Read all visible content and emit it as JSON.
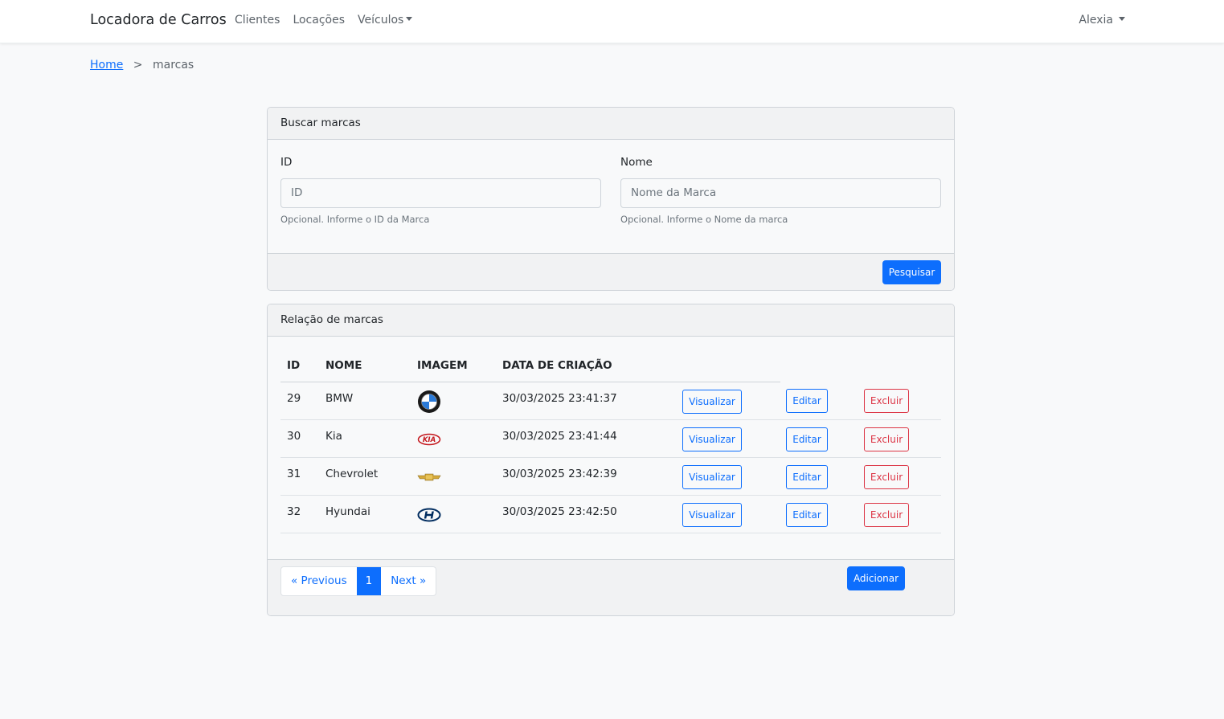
{
  "navbar": {
    "brand": "Locadora de Carros",
    "links": [
      "Clientes",
      "Locações",
      "Veículos"
    ],
    "user": "Alexia"
  },
  "breadcrumb": {
    "home": "Home",
    "separator": ">",
    "current": "marcas"
  },
  "search": {
    "title": "Buscar marcas",
    "id_label": "ID",
    "id_placeholder": "ID",
    "id_help": "Opcional. Informe o ID da Marca",
    "name_label": "Nome",
    "name_placeholder": "Nome da Marca",
    "name_help": "Opcional. Informe o Nome da marca",
    "submit": "Pesquisar"
  },
  "list": {
    "title": "Relação de marcas",
    "columns": [
      "ID",
      "NOME",
      "IMAGEM",
      "DATA DE CRIAÇÃO"
    ],
    "rows": [
      {
        "id": "29",
        "name": "BMW",
        "logo": "bmw-logo",
        "created": "30/03/2025 23:41:37"
      },
      {
        "id": "30",
        "name": "Kia",
        "logo": "kia-logo",
        "created": "30/03/2025 23:41:44"
      },
      {
        "id": "31",
        "name": "Chevrolet",
        "logo": "chevrolet-logo",
        "created": "30/03/2025 23:42:39"
      },
      {
        "id": "32",
        "name": "Hyundai",
        "logo": "hyundai-logo",
        "created": "30/03/2025 23:42:50"
      }
    ],
    "actions": {
      "view": "Visualizar",
      "edit": "Editar",
      "delete": "Excluir"
    },
    "pagination": {
      "prev": "« Previous",
      "current": "1",
      "next": "Next »"
    },
    "add": "Adicionar"
  },
  "colors": {
    "primary": "#0d6efd",
    "danger": "#dc3545",
    "background": "#f8f9fa"
  }
}
